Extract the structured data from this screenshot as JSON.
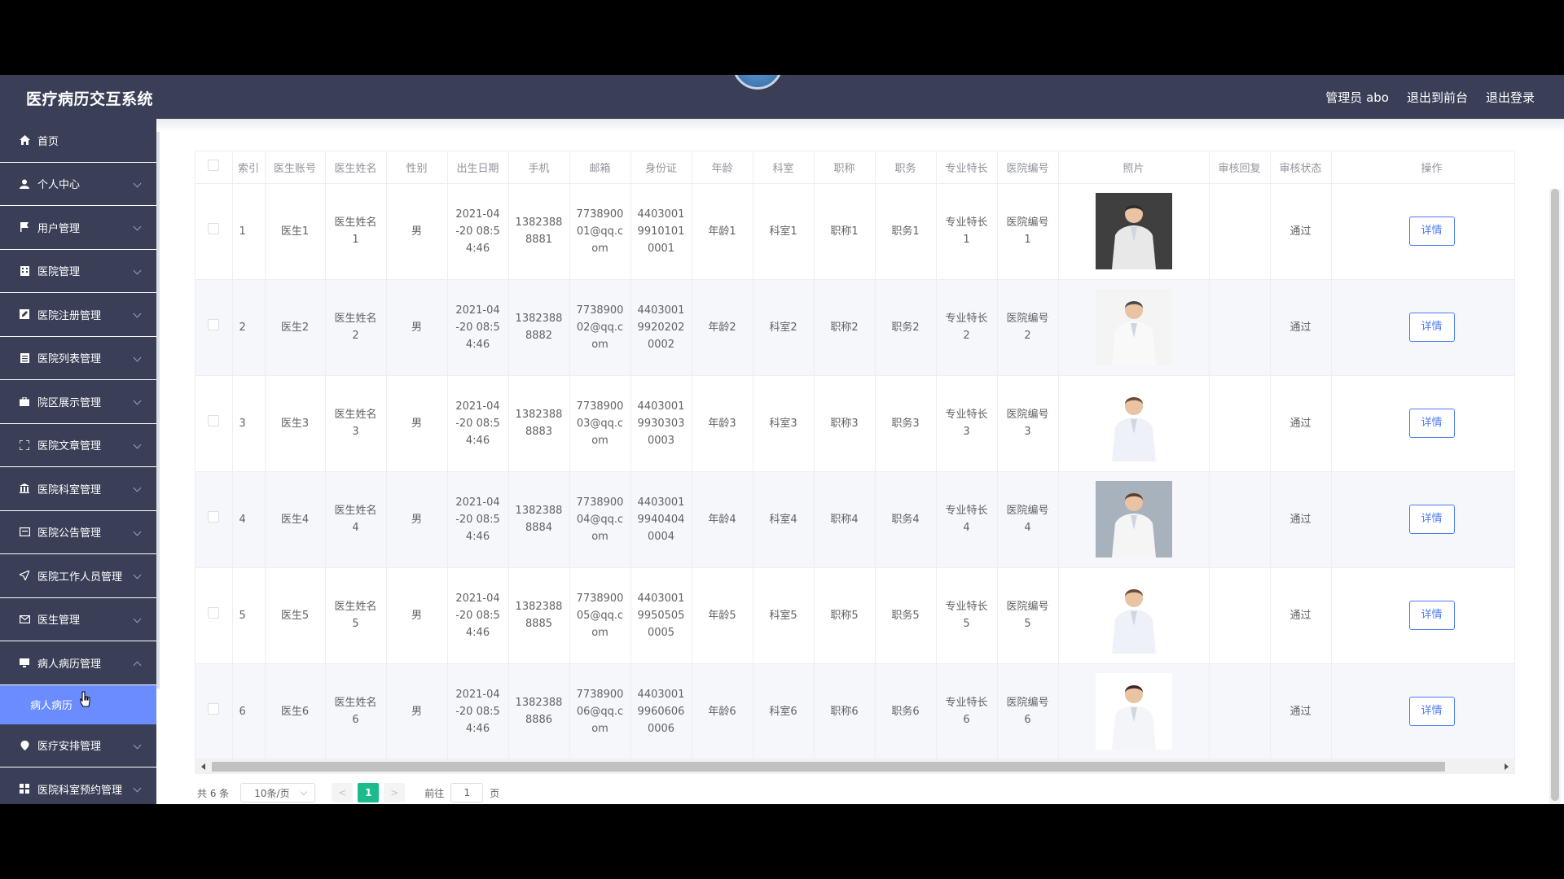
{
  "header": {
    "title": "医疗病历交互系统",
    "links": [
      "管理员 abo",
      "退出到前台",
      "退出登录"
    ]
  },
  "sidebar": {
    "items": [
      {
        "label": "首页",
        "icon": "home-icon",
        "expandable": false
      },
      {
        "label": "个人中心",
        "icon": "user-icon",
        "expandable": true
      },
      {
        "label": "用户管理",
        "icon": "flag-icon",
        "expandable": true
      },
      {
        "label": "医院管理",
        "icon": "building-icon",
        "expandable": true
      },
      {
        "label": "医院注册管理",
        "icon": "edit-icon",
        "expandable": true
      },
      {
        "label": "医院列表管理",
        "icon": "list-icon",
        "expandable": true
      },
      {
        "label": "院区展示管理",
        "icon": "briefcase-icon",
        "expandable": true
      },
      {
        "label": "医院文章管理",
        "icon": "expand-icon",
        "expandable": true
      },
      {
        "label": "医院科室管理",
        "icon": "bank-icon",
        "expandable": true
      },
      {
        "label": "医院公告管理",
        "icon": "card-icon",
        "expandable": true
      },
      {
        "label": "医院工作人员管理",
        "icon": "send-icon",
        "expandable": true
      },
      {
        "label": "医生管理",
        "icon": "mail-icon",
        "expandable": true
      },
      {
        "label": "病人病历管理",
        "icon": "monitor-icon",
        "expandable": true,
        "open": true
      }
    ],
    "submenu_active": "病人病历",
    "items_after": [
      {
        "label": "医疗安排管理",
        "icon": "location-icon",
        "expandable": true
      },
      {
        "label": "医院科室预约管理",
        "icon": "grid-icon",
        "expandable": true
      }
    ]
  },
  "table": {
    "columns": [
      "索引",
      "医生账号",
      "医生姓名",
      "性别",
      "出生日期",
      "手机",
      "邮箱",
      "身份证",
      "年龄",
      "科室",
      "职称",
      "职务",
      "专业特长",
      "医院编号",
      "照片",
      "审核回复",
      "审核状态",
      "操作"
    ],
    "rows": [
      {
        "index": "1",
        "account": "医生1",
        "name": "医生姓名1",
        "gender": "男",
        "birth": "2021-04-20 08:54:46",
        "phone": "13823888881",
        "email": "773890001@qq.com",
        "id_card": "440300199101010001",
        "age": "年龄1",
        "dept": "科室1",
        "title": "职称1",
        "position": "职务1",
        "specialty": "专业特长1",
        "hospital_no": "医院编号1",
        "reply": "",
        "status": "通过",
        "action": "详情",
        "photo": "doctor-photo-1"
      },
      {
        "index": "2",
        "account": "医生2",
        "name": "医生姓名2",
        "gender": "男",
        "birth": "2021-04-20 08:54:46",
        "phone": "13823888882",
        "email": "773890002@qq.com",
        "id_card": "440300199202020002",
        "age": "年龄2",
        "dept": "科室2",
        "title": "职称2",
        "position": "职务2",
        "specialty": "专业特长2",
        "hospital_no": "医院编号2",
        "reply": "",
        "status": "通过",
        "action": "详情",
        "photo": "doctor-photo-2"
      },
      {
        "index": "3",
        "account": "医生3",
        "name": "医生姓名3",
        "gender": "男",
        "birth": "2021-04-20 08:54:46",
        "phone": "13823888883",
        "email": "773890003@qq.com",
        "id_card": "440300199303030003",
        "age": "年龄3",
        "dept": "科室3",
        "title": "职称3",
        "position": "职务3",
        "specialty": "专业特长3",
        "hospital_no": "医院编号3",
        "reply": "",
        "status": "通过",
        "action": "详情",
        "photo": "doctor-photo-3"
      },
      {
        "index": "4",
        "account": "医生4",
        "name": "医生姓名4",
        "gender": "男",
        "birth": "2021-04-20 08:54:46",
        "phone": "13823888884",
        "email": "773890004@qq.com",
        "id_card": "440300199404040004",
        "age": "年龄4",
        "dept": "科室4",
        "title": "职称4",
        "position": "职务4",
        "specialty": "专业特长4",
        "hospital_no": "医院编号4",
        "reply": "",
        "status": "通过",
        "action": "详情",
        "photo": "doctor-photo-4"
      },
      {
        "index": "5",
        "account": "医生5",
        "name": "医生姓名5",
        "gender": "男",
        "birth": "2021-04-20 08:54:46",
        "phone": "13823888885",
        "email": "773890005@qq.com",
        "id_card": "440300199505050005",
        "age": "年龄5",
        "dept": "科室5",
        "title": "职称5",
        "position": "职务5",
        "specialty": "专业特长5",
        "hospital_no": "医院编号5",
        "reply": "",
        "status": "通过",
        "action": "详情",
        "photo": "doctor-photo-5"
      },
      {
        "index": "6",
        "account": "医生6",
        "name": "医生姓名6",
        "gender": "男",
        "birth": "2021-04-20 08:54:46",
        "phone": "13823888886",
        "email": "773890006@qq.com",
        "id_card": "440300199606060006",
        "age": "年龄6",
        "dept": "科室6",
        "title": "职称6",
        "position": "职务6",
        "specialty": "专业特长6",
        "hospital_no": "医院编号6",
        "reply": "",
        "status": "通过",
        "action": "详情",
        "photo": "doctor-photo-6"
      }
    ]
  },
  "pagination": {
    "total": "共 6 条",
    "page_size": "10条/页",
    "current_page": "1",
    "goto_label": "前往",
    "goto_value": "1",
    "goto_suffix": "页",
    "prev": "<",
    "next": ">"
  },
  "colors": {
    "header_bg": "#3a3f57",
    "sidebar_active": "#6a8cff",
    "accent_button": "#4d7cf3",
    "page_current": "#1cbb8c"
  }
}
